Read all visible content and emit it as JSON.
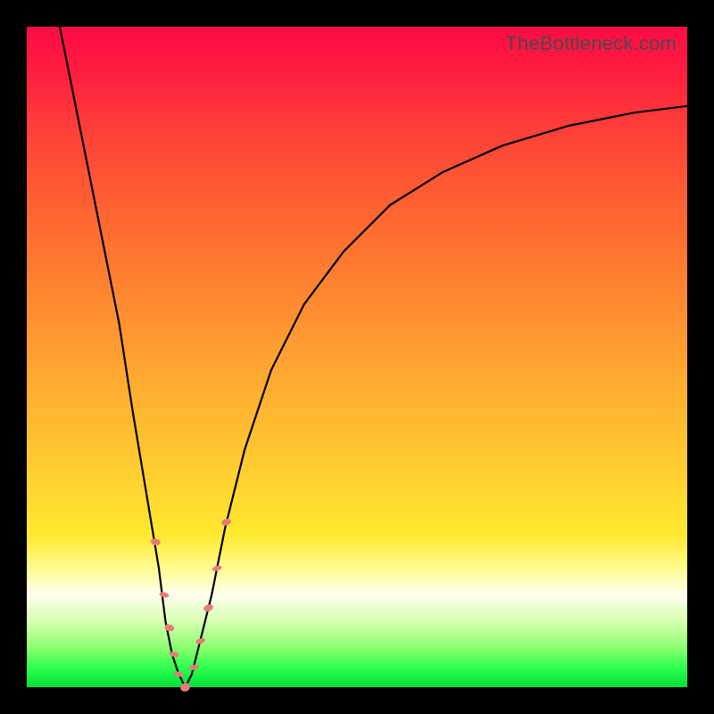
{
  "watermark": {
    "text": "TheBottleneck.com"
  },
  "colors": {
    "frame": "#000000",
    "gradient_top": "#ff0b46",
    "gradient_bottom": "#00e03a",
    "curve": "#000000",
    "marker": "#e77a7a"
  },
  "chart_data": {
    "type": "line",
    "title": "",
    "xlabel": "",
    "ylabel": "",
    "xlim": [
      0,
      100
    ],
    "ylim": [
      0,
      100
    ],
    "note": "Bottleneck-style V-curve. x is a normalized parameter (0–100 across plot width). y is the mismatch percentage (plotted so 0 = bottom/green, 100 = top/red). Values read from pixel positions; no axis labels present in image.",
    "series": [
      {
        "name": "bottleneck-curve",
        "x": [
          5,
          8,
          11,
          14,
          16,
          18,
          20,
          21,
          22,
          23,
          24,
          25,
          26,
          28,
          30,
          33,
          37,
          42,
          48,
          55,
          63,
          72,
          82,
          92,
          100
        ],
        "y": [
          100,
          85,
          70,
          55,
          42,
          30,
          18,
          10,
          5,
          2,
          0,
          2,
          6,
          14,
          24,
          36,
          48,
          58,
          66,
          73,
          78,
          82,
          85,
          87,
          88
        ]
      }
    ],
    "markers": {
      "name": "highlight-points",
      "note": "Salmon pill-shaped markers clustered near the minimum on both branches.",
      "points": [
        {
          "x": 19.5,
          "y": 22,
          "len": 4
        },
        {
          "x": 20.8,
          "y": 14,
          "len": 3
        },
        {
          "x": 21.6,
          "y": 9,
          "len": 4
        },
        {
          "x": 22.3,
          "y": 5,
          "len": 3
        },
        {
          "x": 23.0,
          "y": 2,
          "len": 3
        },
        {
          "x": 24.0,
          "y": 0,
          "len": 5
        },
        {
          "x": 25.3,
          "y": 3,
          "len": 3
        },
        {
          "x": 26.3,
          "y": 7,
          "len": 3
        },
        {
          "x": 27.5,
          "y": 12,
          "len": 4
        },
        {
          "x": 28.8,
          "y": 18,
          "len": 3
        },
        {
          "x": 30.2,
          "y": 25,
          "len": 4
        }
      ]
    }
  }
}
